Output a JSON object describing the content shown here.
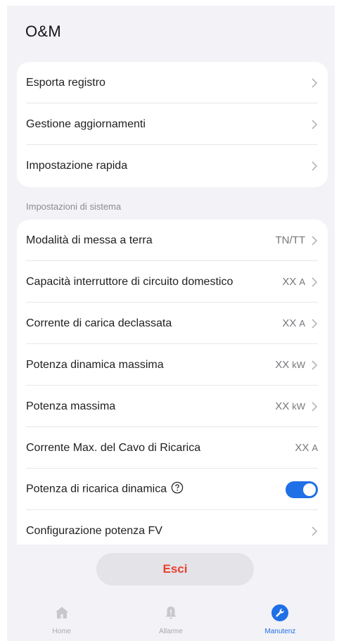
{
  "header": {
    "title": "O&M"
  },
  "menu_top": [
    {
      "label": "Esporta registro"
    },
    {
      "label": "Gestione aggiornamenti"
    },
    {
      "label": "Impostazione rapida"
    }
  ],
  "system": {
    "section_label": "Impostazioni di sistema",
    "earthing": {
      "label": "Modalità di messa a terra",
      "value": "TN/TT"
    },
    "breaker": {
      "label": "Capacità interruttore di circuito domestico",
      "value": "XX",
      "unit": "A"
    },
    "derated_current": {
      "label": "Corrente di carica declassata",
      "value": "XX",
      "unit": "A"
    },
    "max_dynamic_power": {
      "label": "Potenza dinamica massima",
      "value": "XX",
      "unit": "kW"
    },
    "max_power": {
      "label": "Potenza massima",
      "value": "XX",
      "unit": "kW"
    },
    "cable_current": {
      "label": "Corrente Max. del Cavo di Ricarica",
      "value": "XX",
      "unit": "A"
    },
    "dynamic_charging": {
      "label": "Potenza di ricarica dinamica",
      "enabled": true
    },
    "pv_config": {
      "label": "Configurazione potenza FV"
    }
  },
  "exit_button": {
    "label": "Esci"
  },
  "tabbar": {
    "tabs": [
      {
        "label": "Home",
        "icon": "home-icon"
      },
      {
        "label": "Allarme",
        "icon": "bell-icon"
      },
      {
        "label": "Manutenz",
        "icon": "wrench-icon",
        "active": true
      }
    ]
  },
  "colors": {
    "accent": "#1f6fe6",
    "danger": "#e8402f",
    "background": "#f3f2f6"
  }
}
